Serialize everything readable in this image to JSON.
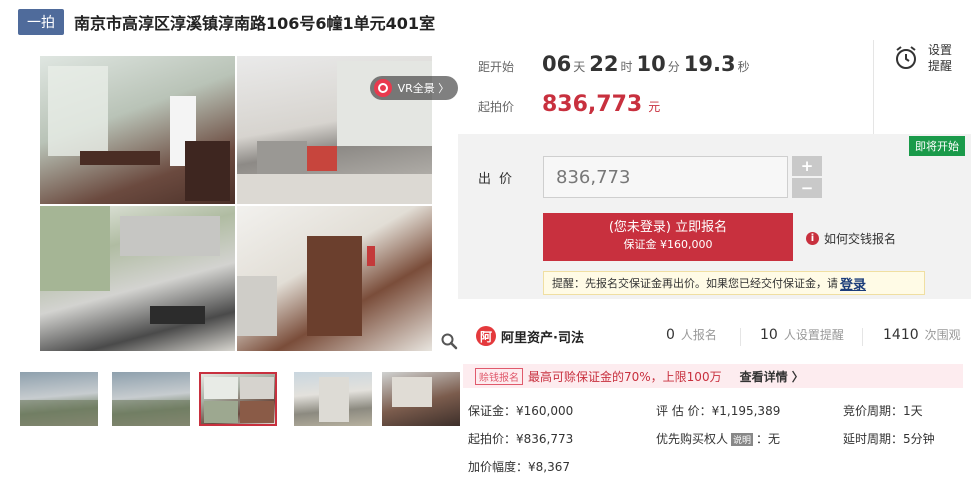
{
  "title": {
    "tag": "一拍",
    "text": "南京市高淳区淳溪镇淳南路106号6幢1单元401室"
  },
  "gallery": {
    "vr_label": "VR全景 〉",
    "thumb_count": 5,
    "active_thumb": 3
  },
  "countdown": {
    "label": "距开始",
    "days": "06",
    "days_unit": "天",
    "hours": "22",
    "hours_unit": "时",
    "minutes": "10",
    "minutes_unit": "分",
    "seconds": "19.3",
    "seconds_unit": "秒"
  },
  "start_price": {
    "label": "起拍价",
    "value": "836,773",
    "unit": "元"
  },
  "reminder": {
    "line1": "设置",
    "line2": "提醒"
  },
  "bid": {
    "status_badge": "即将开始",
    "label": "出价",
    "input_value": "836,773",
    "plus": "+",
    "minus": "−",
    "register_main": "(您未登录) 立即报名",
    "register_sub": "保证金 ¥160,000",
    "how_to_pay": "如何交钱报名",
    "tip_text": "提醒：先报名交保证金再出价。如果您已经交付保证金，请",
    "tip_link": "登录"
  },
  "platform": {
    "logo_mark": "阿",
    "name": "阿里资产·司法"
  },
  "stats": {
    "registered_count": "0",
    "registered_label": "人报名",
    "reminders_count": "10",
    "reminders_label": "人设置提醒",
    "views_count": "1410",
    "views_label": "次围观"
  },
  "promo": {
    "tag": "赊钱报名",
    "text": "最高可赊保证金的70%，上限100万",
    "link": "查看详情 〉"
  },
  "info": {
    "deposit": "保证金：¥160,000",
    "appraisal": "评 估 价：¥1,195,389",
    "cycle": "竞价周期：1天",
    "start_price": "起拍价：¥836,773",
    "priority_label": "优先购买权人",
    "priority_badge": "说明",
    "priority_value": "：无",
    "extension": "延时周期：5分钟",
    "increment": "加价幅度：¥8,367"
  },
  "colors": {
    "accent": "#c8303e",
    "tag_bg": "#4f6b9b",
    "status_green": "#1a9a4a"
  }
}
